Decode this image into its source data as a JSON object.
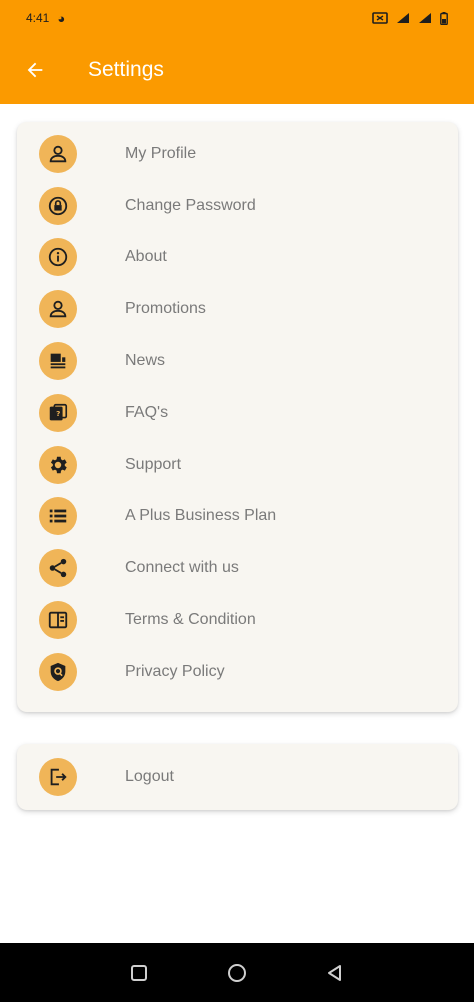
{
  "status_bar": {
    "time": "4:41"
  },
  "app_bar": {
    "title": "Settings",
    "back_icon": "arrow-left-icon"
  },
  "menu": {
    "items": [
      {
        "label": "My Profile",
        "icon": "person-icon"
      },
      {
        "label": "Change Password",
        "icon": "lock-icon"
      },
      {
        "label": "About",
        "icon": "info-icon"
      },
      {
        "label": "Promotions",
        "icon": "person-icon"
      },
      {
        "label": "News",
        "icon": "newspaper-icon"
      },
      {
        "label": "FAQ's",
        "icon": "faq-icon"
      },
      {
        "label": "Support",
        "icon": "gear-icon"
      },
      {
        "label": "A Plus Business Plan",
        "icon": "list-icon"
      },
      {
        "label": "Connect with us",
        "icon": "share-icon"
      },
      {
        "label": "Terms & Condition",
        "icon": "book-icon"
      },
      {
        "label": "Privacy Policy",
        "icon": "shield-icon"
      }
    ]
  },
  "logout": {
    "label": "Logout",
    "icon": "logout-icon"
  },
  "colors": {
    "accent": "#fb9a00",
    "icon_bg": "#f0b558",
    "card_bg": "#f8f6f1",
    "label": "#7a7a7a",
    "icon_fg": "#1f1f1f"
  }
}
